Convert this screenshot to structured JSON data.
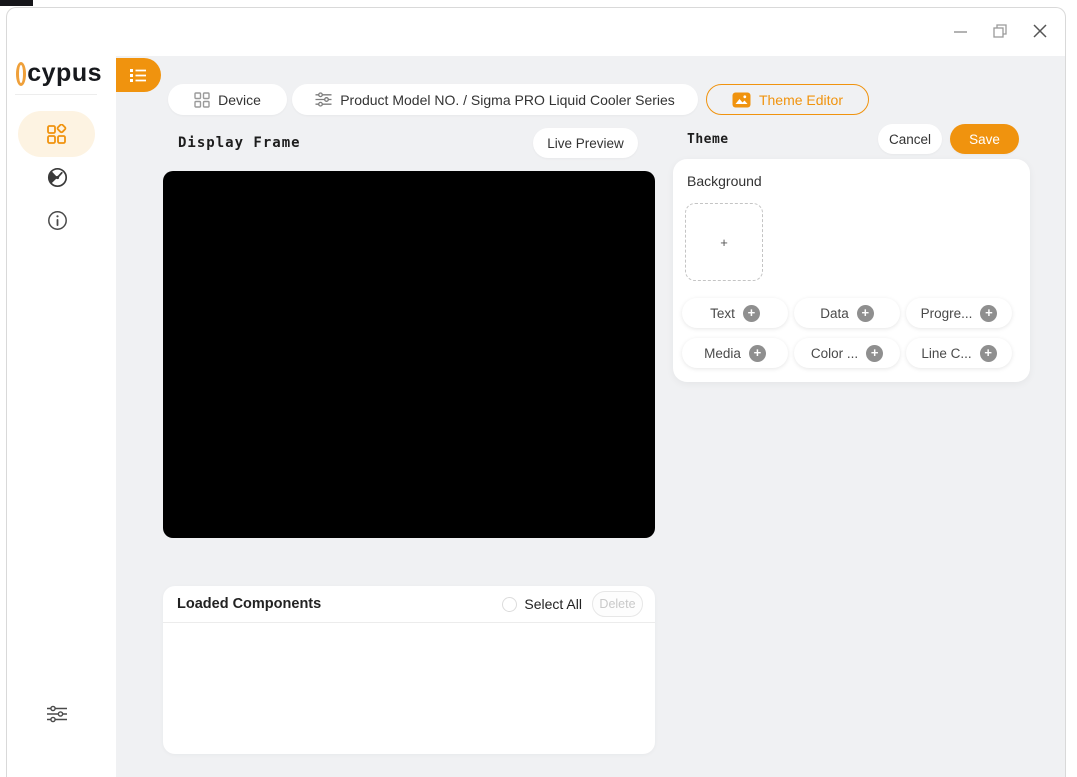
{
  "brand": {
    "logo_text": "cypus"
  },
  "titlebar": {
    "controls": [
      "minimize",
      "maximize",
      "close"
    ]
  },
  "sidebar": {
    "items": [
      "dashboard",
      "monitor",
      "about"
    ],
    "bottom_item": "settings"
  },
  "topbar": {
    "device_label": "Device",
    "product_label": "Product Model NO. / Sigma PRO Liquid Cooler Series",
    "theme_editor_label": "Theme Editor"
  },
  "display": {
    "title": "Display Frame",
    "live_preview_label": "Live Preview"
  },
  "theme_panel": {
    "title": "Theme",
    "cancel_label": "Cancel",
    "save_label": "Save",
    "background_label": "Background",
    "add_symbol": "+",
    "plus_symbol": "+",
    "component_buttons": [
      "Text",
      "Data",
      "Progre...",
      "Media",
      "Color ...",
      "Line C..."
    ]
  },
  "loaded_components": {
    "title": "Loaded Components",
    "select_all_label": "Select All",
    "delete_label": "Delete"
  },
  "colors": {
    "accent": "#F0930E",
    "accent_soft": "#FDF3E2",
    "content_bg": "#F0F1F3",
    "canvas": "#000000"
  }
}
